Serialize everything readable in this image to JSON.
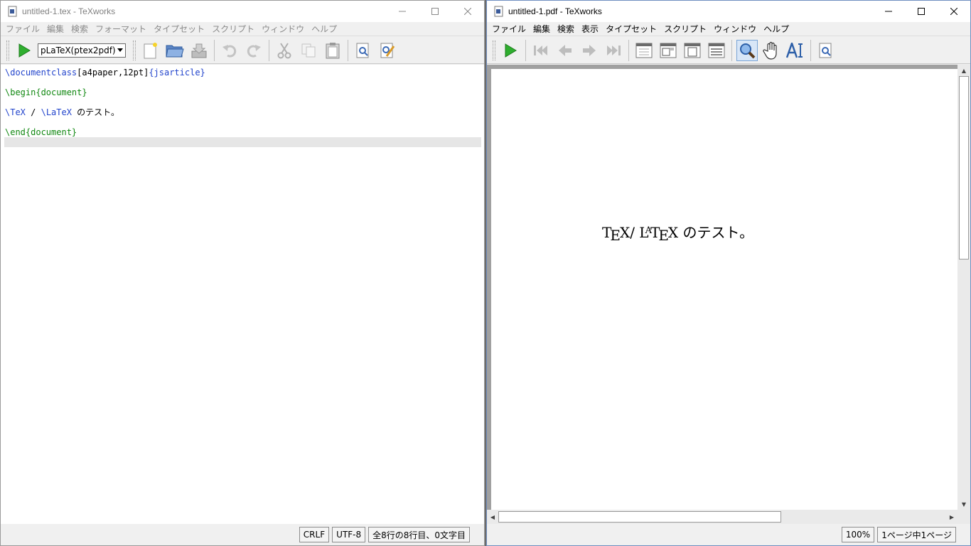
{
  "editor": {
    "title": "untitled-1.tex - TeXworks",
    "menu": [
      "ファイル",
      "編集",
      "検索",
      "フォーマット",
      "タイプセット",
      "スクリプト",
      "ウィンドウ",
      "ヘルプ"
    ],
    "typeset_engine": "pLaTeX(ptex2pdf)",
    "lines": {
      "l1_cmd": "\\documentclass",
      "l1_opt": "[a4paper,12pt]",
      "l1_arg": "{jsarticle}",
      "l3_cmd": "\\begin",
      "l3_arg": "{document}",
      "l5_a": "\\TeX",
      "l5_b": " / ",
      "l5_c": "\\LaTeX",
      "l5_d": " のテスト。",
      "l7_cmd": "\\end",
      "l7_arg": "{document}"
    },
    "status": {
      "line_ending": "CRLF",
      "encoding": "UTF-8",
      "position": "全8行の8行目、0文字目"
    }
  },
  "viewer": {
    "title": "untitled-1.pdf - TeXworks",
    "menu": [
      "ファイル",
      "編集",
      "検索",
      "表示",
      "タイプセット",
      "スクリプト",
      "ウィンドウ",
      "ヘルプ"
    ],
    "pdf_text_suffix": " のテスト。",
    "status": {
      "zoom": "100%",
      "page": "1ページ中1ページ"
    }
  },
  "colors": {
    "keyword": "#2244cc",
    "environment": "#118811",
    "run_green": "#2fae2f"
  }
}
